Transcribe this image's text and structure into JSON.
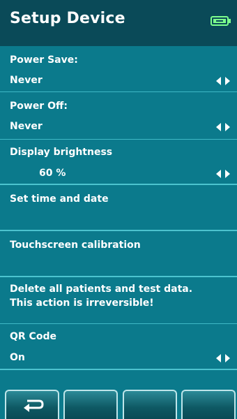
{
  "header": {
    "title": "Setup Device",
    "battery_icon": "battery-icon"
  },
  "settings": {
    "power_save": {
      "label": "Power Save:",
      "value": "Never"
    },
    "power_off": {
      "label": "Power Off:",
      "value": "Never"
    },
    "display_brightness": {
      "label": "Display brightness",
      "value": "60 %"
    },
    "set_time": {
      "label": "Set time and date"
    },
    "touch_calibration": {
      "label": "Touchscreen calibration"
    },
    "delete_all": {
      "line1": "Delete all patients and test data.",
      "line2": "This action is irreversible!"
    },
    "qr_code": {
      "label": "QR Code",
      "value": "On"
    }
  },
  "footer": {
    "buttons": [
      {
        "icon": "back-arrow-icon"
      },
      {
        "icon": ""
      },
      {
        "icon": ""
      },
      {
        "icon": ""
      }
    ]
  },
  "colors": {
    "background": "#0b7a8c",
    "header": "#0a4a58",
    "divider": "#4cc3cf"
  }
}
